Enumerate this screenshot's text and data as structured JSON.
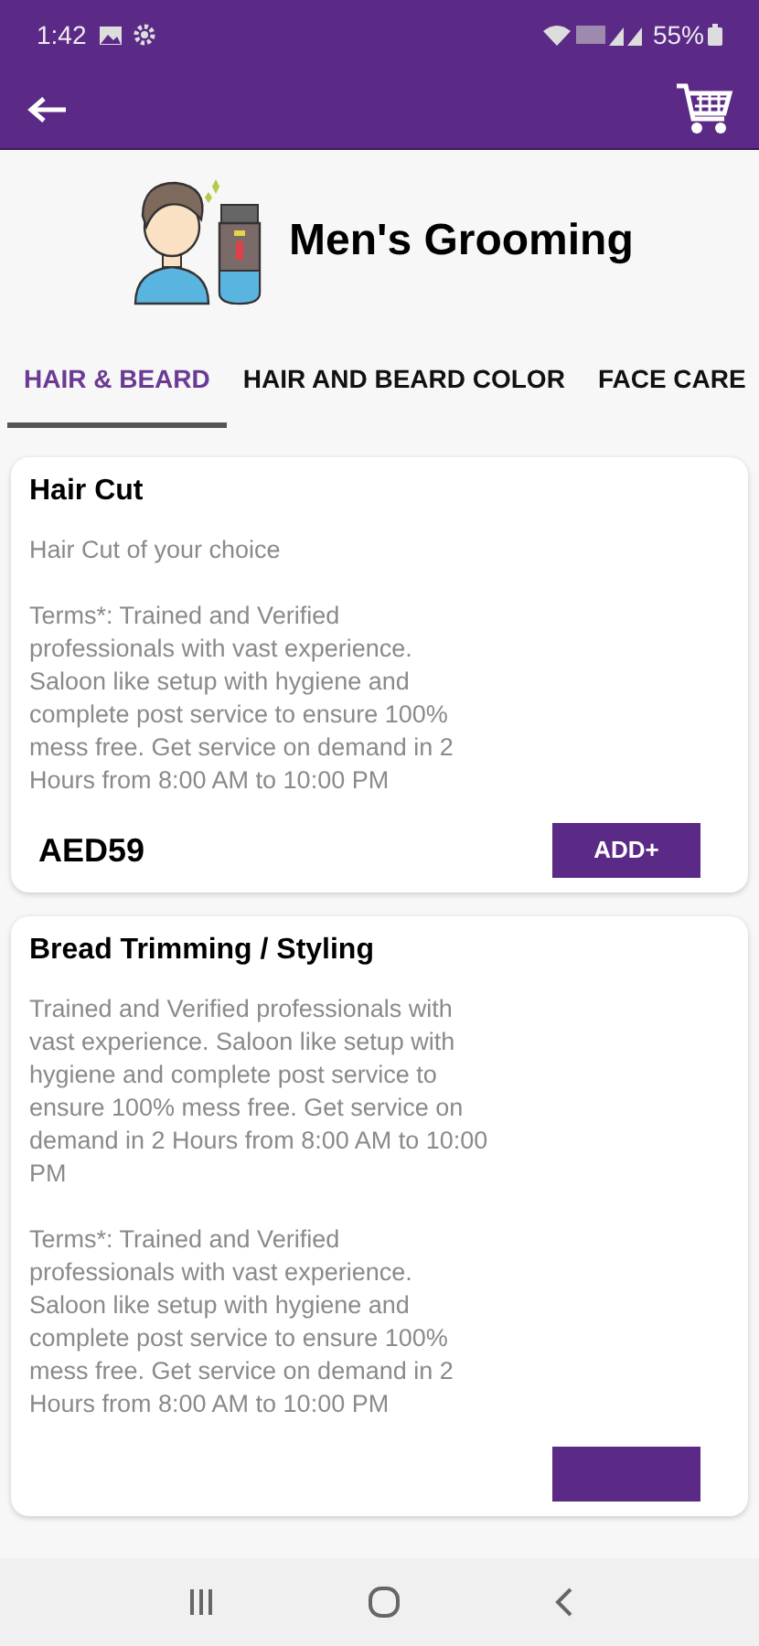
{
  "status_bar": {
    "time": "1:42",
    "battery": "55%"
  },
  "header": {
    "title": "Men's Grooming"
  },
  "tabs": [
    {
      "label": "HAIR & BEARD",
      "selected": true
    },
    {
      "label": "HAIR AND BEARD COLOR",
      "selected": false
    },
    {
      "label": "FACE CARE",
      "selected": false
    }
  ],
  "services": [
    {
      "title": "Hair Cut",
      "paragraphs": [
        "Hair Cut of your choice",
        "Terms*: Trained and Verified professionals with vast experience. Saloon like setup with hygiene and complete post service to ensure 100% mess free. Get service on demand in 2 Hours from 8:00 AM to 10:00 PM"
      ],
      "price": "AED59",
      "button": "ADD+"
    },
    {
      "title": "Bread Trimming / Styling",
      "paragraphs": [
        "Trained and Verified professionals with vast experience. Saloon like setup with hygiene and complete post service to ensure 100% mess free. Get service on demand in 2 Hours from 8:00 AM to 10:00 PM",
        "Terms*: Trained and Verified professionals with vast experience. Saloon like setup with hygiene and complete post service to ensure 100% mess free. Get service on demand in 2 Hours from 8:00 AM to 10:00 PM"
      ]
    }
  ]
}
